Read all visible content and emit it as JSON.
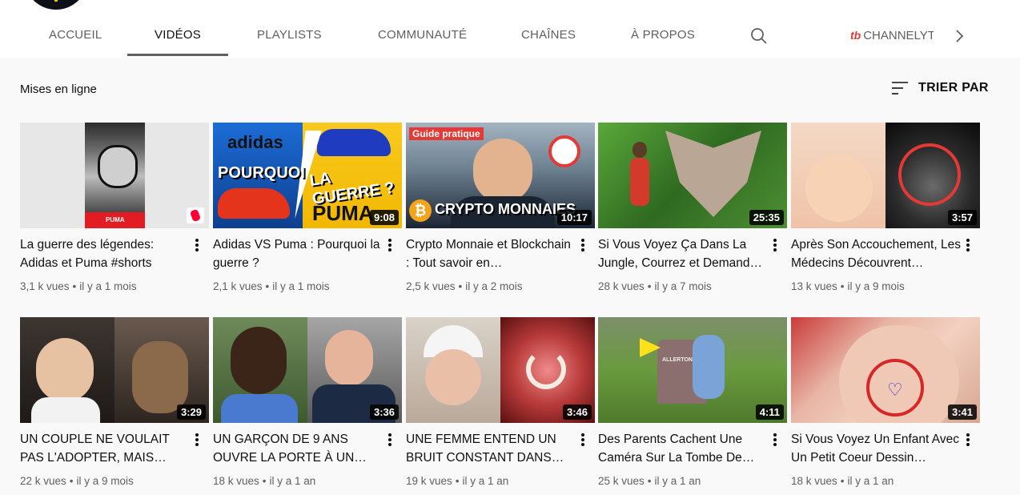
{
  "tabs": [
    {
      "label": "ACCUEIL"
    },
    {
      "label": "VIDÉOS",
      "active": true
    },
    {
      "label": "PLAYLISTS"
    },
    {
      "label": "COMMUNAUTÉ"
    },
    {
      "label": "CHAÎNES"
    },
    {
      "label": "À PROPOS"
    }
  ],
  "brand_tab": {
    "logo": "tb",
    "label": "CHANNELYTICS"
  },
  "section": {
    "title": "Mises en ligne",
    "sort_label": "TRIER PAR"
  },
  "colors": {
    "accent": "#e53935",
    "text": "#0f0f0f",
    "meta": "#606060",
    "background": "#f9f9f9"
  },
  "icons": {
    "search": "search-icon",
    "next": "chevron-right-icon",
    "sort": "sort-icon",
    "more": "more-vert-icon",
    "shorts": "shorts-icon"
  },
  "videos": [
    {
      "title": "La guerre des légendes: Adidas et Puma #shorts",
      "duration": "",
      "shorts": true,
      "views": "3,1 k vues",
      "age": "il y a 1 mois",
      "thumb_text": [
        "PUMA"
      ]
    },
    {
      "title": "Adidas VS Puma : Pourquoi la guerre ?",
      "duration": "9:08",
      "views": "2,1 k vues",
      "age": "il y a 1 mois",
      "thumb_text": [
        "adidas",
        "POURQUOI",
        "LA GUERRE ?",
        "PUMA"
      ]
    },
    {
      "title": "Crypto Monnaie et Blockchain : Tout savoir en…",
      "duration": "10:17",
      "views": "2,5 k vues",
      "age": "il y a 2 mois",
      "thumb_text": [
        "Guide pratique",
        "CRYPTO MONNAIES",
        "₿"
      ]
    },
    {
      "title": "Si Vous Voyez Ça Dans La Jungle, Courrez et Demand…",
      "duration": "25:35",
      "views": "28 k vues",
      "age": "il y a 7 mois",
      "thumb_text": []
    },
    {
      "title": "Après Son Accouchement, Les Médecins Découvrent…",
      "duration": "3:57",
      "views": "13 k vues",
      "age": "il y a 9 mois",
      "thumb_text": []
    },
    {
      "title": "UN COUPLE NE VOULAIT PAS L'ADOPTER, MAIS DÈS…",
      "duration": "3:29",
      "views": "22 k vues",
      "age": "il y a 9 mois",
      "thumb_text": []
    },
    {
      "title": "UN GARÇON DE 9 ANS OUVRE LA PORTE À UN…",
      "duration": "3:36",
      "views": "18 k vues",
      "age": "il y a 1 an",
      "thumb_text": []
    },
    {
      "title": "UNE FEMME ENTEND UN BRUIT CONSTANT DANS SA…",
      "duration": "3:46",
      "views": "19 k vues",
      "age": "il y a 1 an",
      "thumb_text": []
    },
    {
      "title": "Des Parents Cachent Une Caméra Sur La Tombe De…",
      "duration": "4:11",
      "views": "25 k vues",
      "age": "il y a 1 an",
      "thumb_text": [
        "ALLERTON"
      ]
    },
    {
      "title": "Si Vous Voyez Un Enfant Avec Un Petit Coeur Dessin…",
      "duration": "3:41",
      "views": "18 k vues",
      "age": "il y a 1 an",
      "thumb_text": []
    }
  ]
}
